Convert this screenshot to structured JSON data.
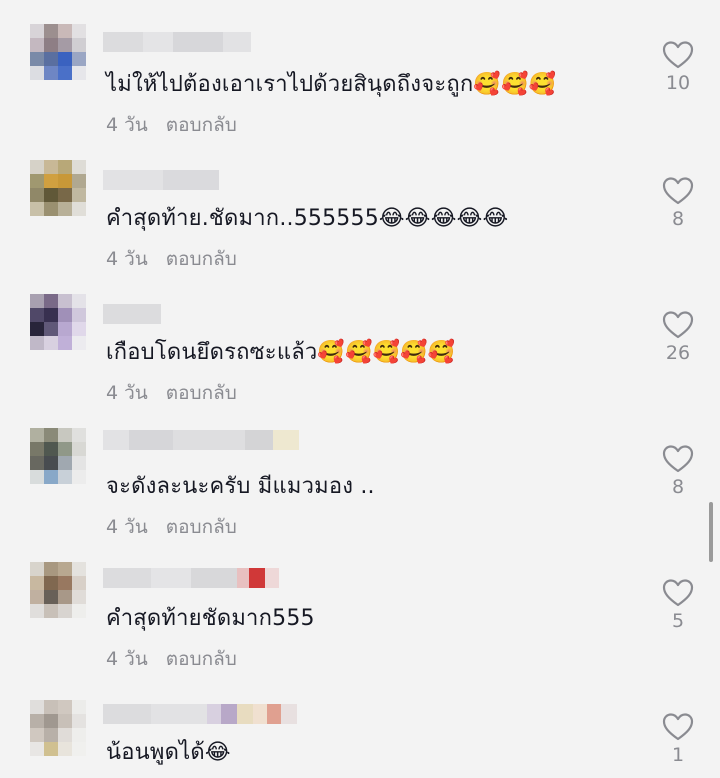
{
  "comments": [
    {
      "text": "ไม่ให้ไปต้องเอาเราไปด้วยสินุดถึงจะถูก🥰🥰🥰",
      "age": "4 วัน",
      "reply": "ตอบกลับ",
      "likes": "10"
    },
    {
      "text": "คำสุดท้าย.ชัดมาก..555555😂😂😂😂😂",
      "age": "4 วัน",
      "reply": "ตอบกลับ",
      "likes": "8"
    },
    {
      "text": "เกือบโดนยึดรถซะแล้ว🥰🥰🥰🥰🥰",
      "age": "4 วัน",
      "reply": "ตอบกลับ",
      "likes": "26"
    },
    {
      "text": "จะดังละนะครับ มีแมวมอง ..",
      "age": "4 วัน",
      "reply": "ตอบกลับ",
      "likes": "8"
    },
    {
      "text": "คำสุดท้ายชัดมาก555",
      "age": "4 วัน",
      "reply": "ตอบกลับ",
      "likes": "5"
    },
    {
      "text": "น้อนพูดได้😂",
      "age": "",
      "reply": "",
      "likes": "1"
    }
  ],
  "icons": {
    "like": "heart-outline-icon"
  },
  "colors": {
    "text": "#161823",
    "meta": "#8a8b91",
    "background": "#f3f3f3"
  }
}
